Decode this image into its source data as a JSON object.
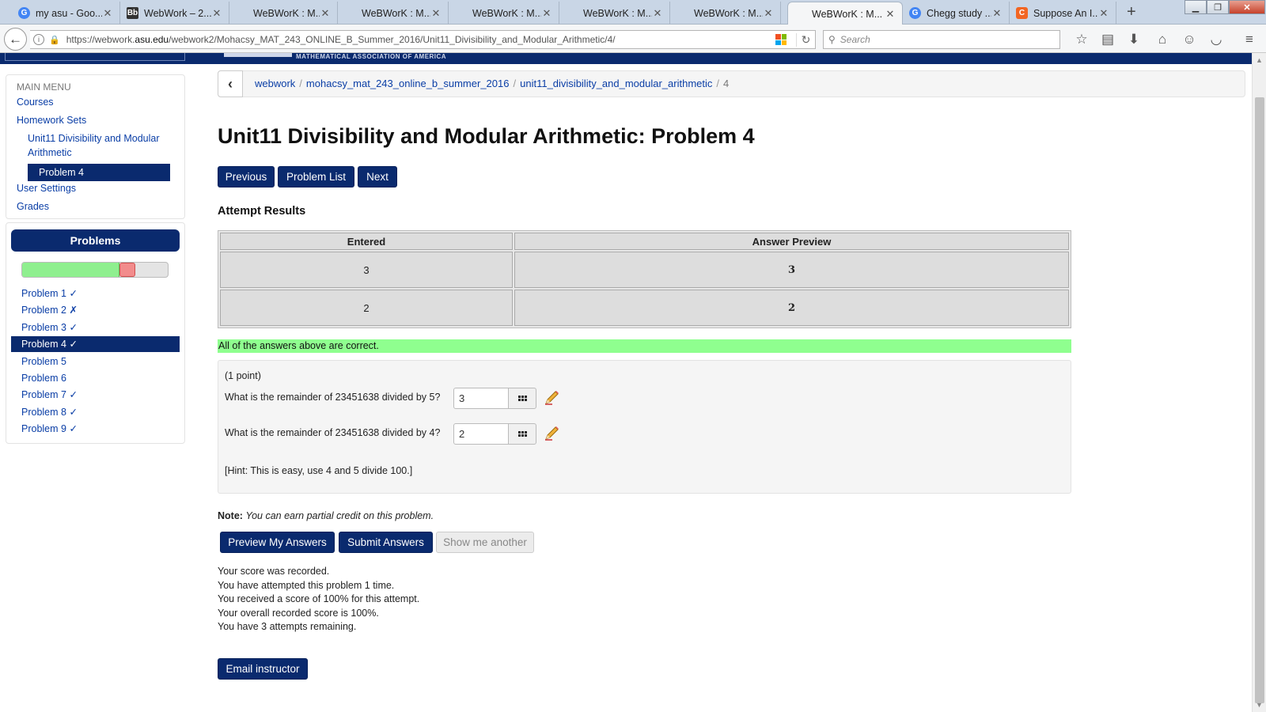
{
  "browser": {
    "tabs": [
      {
        "title": "my asu - Goo...",
        "icon": "google-g",
        "color": "#4285f4"
      },
      {
        "title": "WebWork – 2...",
        "icon": "blackboard-bb",
        "color": "#333333"
      },
      {
        "title": "WeBWorK : M...",
        "icon": "none",
        "color": ""
      },
      {
        "title": "WeBWorK : M...",
        "icon": "none",
        "color": ""
      },
      {
        "title": "WeBWorK : M...",
        "icon": "none",
        "color": ""
      },
      {
        "title": "WeBWorK : M...",
        "icon": "none",
        "color": ""
      },
      {
        "title": "WeBWorK : M...",
        "icon": "none",
        "color": ""
      },
      {
        "title": "WeBWorK : M...",
        "icon": "none",
        "color": ""
      },
      {
        "title": "Chegg study ...",
        "icon": "google-g",
        "color": "#4285f4"
      },
      {
        "title": "Suppose An I...",
        "icon": "chegg-c",
        "color": "#f26522"
      }
    ],
    "url_prefix": "https://webwork.",
    "url_domain": "asu.edu",
    "url_suffix": "/webwork2/Mohacsy_MAT_243_ONLINE_B_Summer_2016/Unit11_Divisibility_and_Modular_Arithmetic/4/",
    "search_placeholder": "Search"
  },
  "main_menu": {
    "header": "MAIN MENU",
    "courses": "Courses",
    "homework_sets": "Homework Sets",
    "current_set": "Unit11 Divisibility and Modular Arithmetic",
    "current_problem": "Problem 4",
    "user_settings": "User Settings",
    "grades": "Grades"
  },
  "problems_panel": {
    "title": "Problems",
    "progress": {
      "correct_fraction": 0.667,
      "incorrect_fraction": 0.111
    },
    "items": [
      {
        "label": "Problem 1 ✓"
      },
      {
        "label": "Problem 2 ✗"
      },
      {
        "label": "Problem 3 ✓"
      },
      {
        "label": "Problem 4 ✓",
        "active": true
      },
      {
        "label": "Problem 5"
      },
      {
        "label": "Problem 6"
      },
      {
        "label": "Problem 7 ✓"
      },
      {
        "label": "Problem 8 ✓"
      },
      {
        "label": "Problem 9 ✓"
      }
    ]
  },
  "breadcrumb": {
    "items": [
      "webwork",
      "mohacsy_mat_243_online_b_summer_2016",
      "unit11_divisibility_and_modular_arithmetic"
    ],
    "sep": "/",
    "current": "4"
  },
  "page_title": "Unit11 Divisibility and Modular Arithmetic: Problem 4",
  "nav_buttons": {
    "previous": "Previous",
    "problem_list": "Problem List",
    "next": "Next"
  },
  "attempt_results": {
    "title": "Attempt Results",
    "headers": [
      "Entered",
      "Answer Preview"
    ],
    "rows": [
      {
        "entered": "3",
        "preview": "3"
      },
      {
        "entered": "2",
        "preview": "2"
      }
    ],
    "message": "All of the answers above are correct."
  },
  "problem": {
    "points": "(1 point)",
    "questions": [
      {
        "text": "What is the remainder of 23451638 divided by 5?",
        "answer": "3"
      },
      {
        "text": "What is the remainder of 23451638 divided by 4?",
        "answer": "2"
      }
    ],
    "hint": "[Hint: This is easy, use 4 and 5 divide 100.]"
  },
  "note": {
    "label": "Note:",
    "text": "You can earn partial credit on this problem."
  },
  "actions": {
    "preview": "Preview My Answers",
    "submit": "Submit Answers",
    "show_another": "Show me another"
  },
  "status_lines": [
    "Your score was recorded.",
    "You have attempted this problem 1 time.",
    "You received a score of 100% for this attempt.",
    "Your overall recorded score is 100%.",
    "You have 3 attempts remaining."
  ],
  "email_instructor": "Email instructor",
  "colors": {
    "brand_navy": "#0a2a6e",
    "link_blue": "#0a3ea6",
    "correct_green": "#8fff8f"
  }
}
